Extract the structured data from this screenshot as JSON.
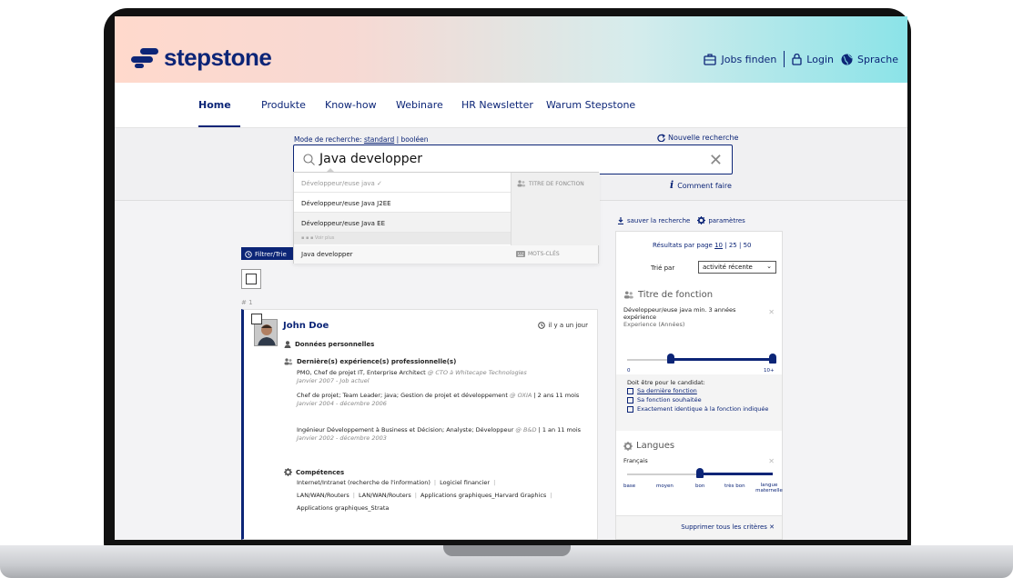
{
  "header": {
    "brand": "stepstone",
    "links": [
      "Jobs finden",
      "Login",
      "Sprache"
    ]
  },
  "nav": {
    "items": [
      "Home",
      "Produkte",
      "Know-how",
      "Webinare",
      "HR Newsletter",
      "Warum Stepstone"
    ],
    "active": "Home"
  },
  "search": {
    "mode_label": "Mode de recherche:",
    "mode_standard": "standard",
    "mode_sep": "|",
    "mode_boolean": "booléen",
    "new_search": "Nouvelle recherche",
    "query": "Java developper",
    "help": "Comment faire",
    "suggestions": {
      "typed": "Développeur/euse java ✓",
      "rows": [
        "Développeur/euse Java J2EE",
        "Développeur/euse Java EE"
      ],
      "more": "▪ ▪ ▪  Voir plus",
      "category_title": "TITRE DE FONCTION",
      "keyword_row": "Java developper",
      "category_keywords": "MOTS-CLÉS"
    }
  },
  "results": {
    "filter_label": "Filtrer/Trie",
    "index": "# 1",
    "candidate": {
      "name": "John Doe",
      "ago": "il y a un jour",
      "personal": "Données personnelles",
      "experience_title": "Dernière(s) expérience(s) professionnelle(s)",
      "experiences": [
        {
          "role": "PMO, Chef de projet IT, Enterprise Architect",
          "at": "@ CTO à Whitecape Technologies",
          "date": "Janvier 2007 - Job actuel"
        },
        {
          "role": "Chef de projet; Team Leader; java; Gestion de projet et développement",
          "at": "@ OXIA",
          "dur": "|  2 ans 11 mois",
          "date": "Janvier 2004 - décembre 2006"
        },
        {
          "role": "Ingénieur Développement à Business et Décision; Analyste; Développeur",
          "at": "@ B&D",
          "dur": "|  1 an 11 mois",
          "date": "Janvier 2002 - décembre 2003"
        }
      ],
      "skills_title": "Compétences",
      "skills_lines": [
        [
          "Internet/Intranet (recherche de l'information)",
          "Logiciel financier"
        ],
        [
          "LAN/WAN/Routers",
          "LAN/WAN/Routers",
          "Applications graphiques_Harvard Graphics"
        ],
        [
          "Applications graphiques_Strata"
        ]
      ]
    }
  },
  "panel": {
    "save": "sauver la recherche",
    "settings": "paramètres",
    "per_page_label": "Résultats par page",
    "per_page_options": [
      "10",
      "25",
      "50"
    ],
    "per_page_selected": "10",
    "sort_label": "Trié par",
    "sort_value": "activité récente",
    "job_title_section": "Titre de fonction",
    "job_title_value": "Développeur/euse java",
    "job_title_min": "min. 3 années",
    "job_title_exp": "expérience",
    "experience_label": "Experience (Années)",
    "exp_min_label": "0",
    "exp_max_label": "10+",
    "exp_range": [
      3,
      10
    ],
    "candidate_label": "Doit être pour le candidat:",
    "candidate_opts": [
      "Sa dernière fonction",
      "Sa fonction souhaitée",
      "Exactement identique à la fonction indiquée"
    ],
    "lang_section": "Langues",
    "lang_value": "Français",
    "lang_levels": [
      "base",
      "moyen",
      "bon",
      "très bon",
      "langue maternelle"
    ],
    "lang_level_selected": "bon",
    "clear_all": "Supprimer tous les critères ✕"
  },
  "colors": {
    "brand": "#0c2577",
    "gradient_right": "#8be3e8",
    "gradient_left": "#ffd9cc"
  }
}
